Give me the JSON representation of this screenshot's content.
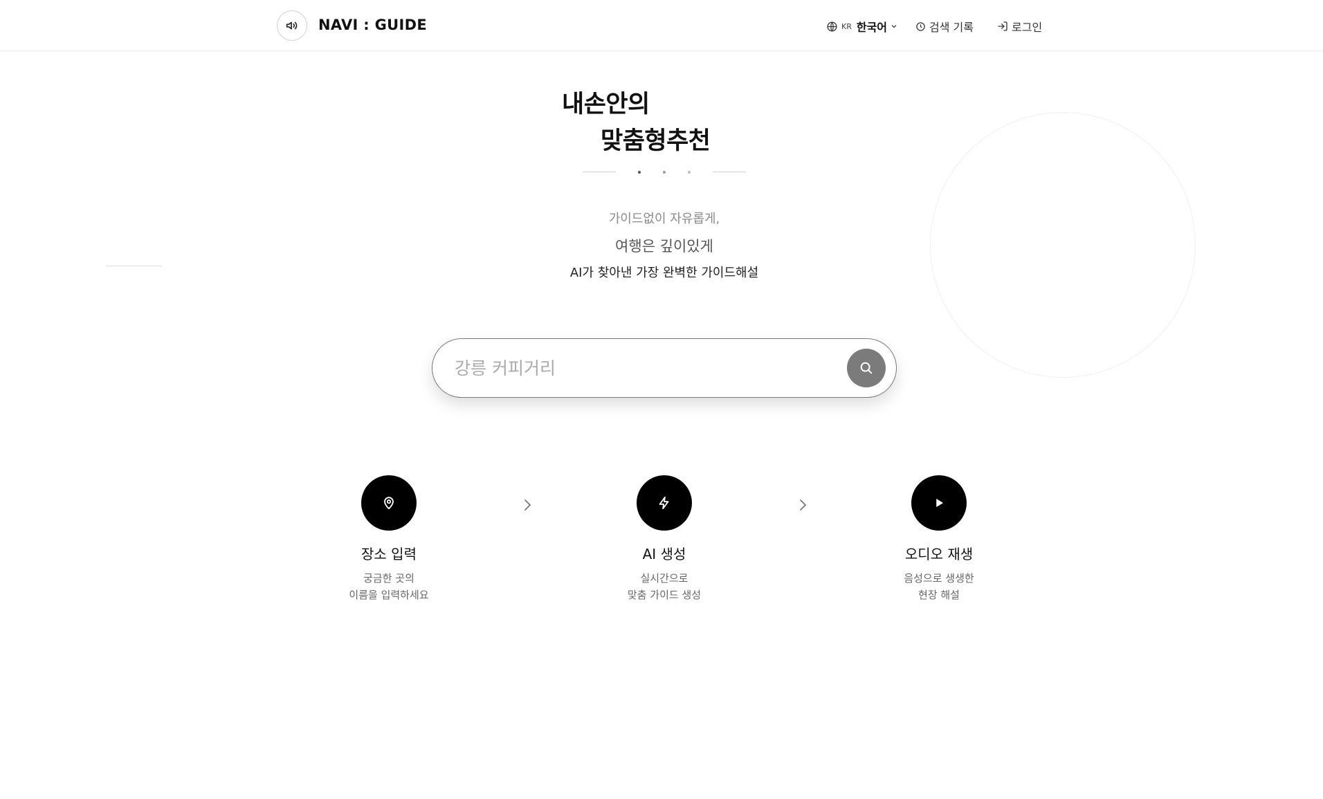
{
  "header": {
    "logo_text": "NAVI : GUIDE",
    "logo_icon": "speaker-volume-icon",
    "language": {
      "icon": "globe-icon",
      "code": "KR",
      "label": "한국어",
      "chevron": "chevron-down-icon"
    },
    "history": {
      "icon": "clock-icon",
      "label": "검색 기록"
    },
    "login": {
      "icon": "login-arrow-icon",
      "label": "로그인"
    }
  },
  "hero": {
    "title_line1": "내손안의",
    "title_line2": "맞춤형추천",
    "subtitle1": "가이드없이 자유롭게,",
    "subtitle2": "여행은 깊이있게",
    "subtitle3": "AI가 찾아낸 가장 완벽한 가이드해설"
  },
  "search": {
    "placeholder": "강릉 커피거리",
    "value": "",
    "button_icon": "search-icon",
    "button_color": "#7b7b7b"
  },
  "steps": [
    {
      "icon": "map-pin-icon",
      "title": "장소 입력",
      "desc_line1": "궁금한 곳의",
      "desc_line2": "이름을 입력하세요"
    },
    {
      "icon": "lightning-icon",
      "title": "AI 생성",
      "desc_line1": "실시간으로",
      "desc_line2": "맞춤 가이드 생성"
    },
    {
      "icon": "play-icon",
      "title": "오디오 재생",
      "desc_line1": "음성으로 생생한",
      "desc_line2": "현장 해설"
    }
  ],
  "colors": {
    "accent": "#000000",
    "text": "#111111",
    "muted": "#666666"
  }
}
